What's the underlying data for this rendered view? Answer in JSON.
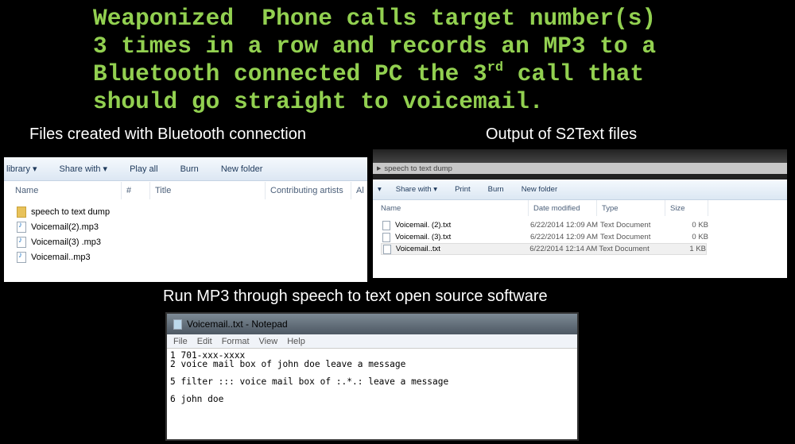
{
  "headline": {
    "line1": "Weaponized  Phone calls target number(s)",
    "line2": "3 times in a row and records an MP3 to a",
    "line3_pre": "Bluetooth connected PC the 3",
    "line3_sup": "rd",
    "line3_post": " call that",
    "line4": "should go straight to voicemail."
  },
  "captions": {
    "left": "Files created with Bluetooth connection",
    "right": "Output of S2Text files",
    "bottom": "Run MP3 through speech to text open source software"
  },
  "explorer_left": {
    "toolbar": [
      "library ▾",
      "Share with ▾",
      "Play all",
      "Burn",
      "New folder"
    ],
    "columns": [
      "Name",
      "#",
      "Title",
      "Contributing artists",
      "Al"
    ],
    "items": [
      {
        "name": "speech to text dump",
        "icon": "folder-icon"
      },
      {
        "name": "Voicemail(2).mp3",
        "icon": "audio-file-icon"
      },
      {
        "name": "Voicemail(3) .mp3",
        "icon": "audio-file-icon"
      },
      {
        "name": "Voicemail..mp3",
        "icon": "audio-file-icon"
      }
    ]
  },
  "explorer_right": {
    "breadcrumb": "speech to text dump",
    "toolbar": [
      "▾",
      "Share with ▾",
      "Print",
      "Burn",
      "New folder"
    ],
    "columns": [
      "Name",
      "Date modified",
      "Type",
      "Size"
    ],
    "items": [
      {
        "name": "Voicemail. (2).txt",
        "date": "6/22/2014 12:09 AM",
        "type": "Text Document",
        "size": "0 KB"
      },
      {
        "name": "Voicemail. (3).txt",
        "date": "6/22/2014 12:09 AM",
        "type": "Text Document",
        "size": "0 KB"
      },
      {
        "name": "Voicemail..txt",
        "date": "6/22/2014 12:14 AM",
        "type": "Text Document",
        "size": "1 KB"
      }
    ]
  },
  "notepad": {
    "title": "Voicemail..txt - Notepad",
    "menu": [
      "File",
      "Edit",
      "Format",
      "View",
      "Help"
    ],
    "content": "1 701-xxx-xxxx\n2 voice mail box of john doe leave a message\n\n5 filter ::: voice mail box of :.*.: leave a message\n\n6 john doe"
  },
  "colors": {
    "headline": "#92d050",
    "background": "#000000"
  }
}
